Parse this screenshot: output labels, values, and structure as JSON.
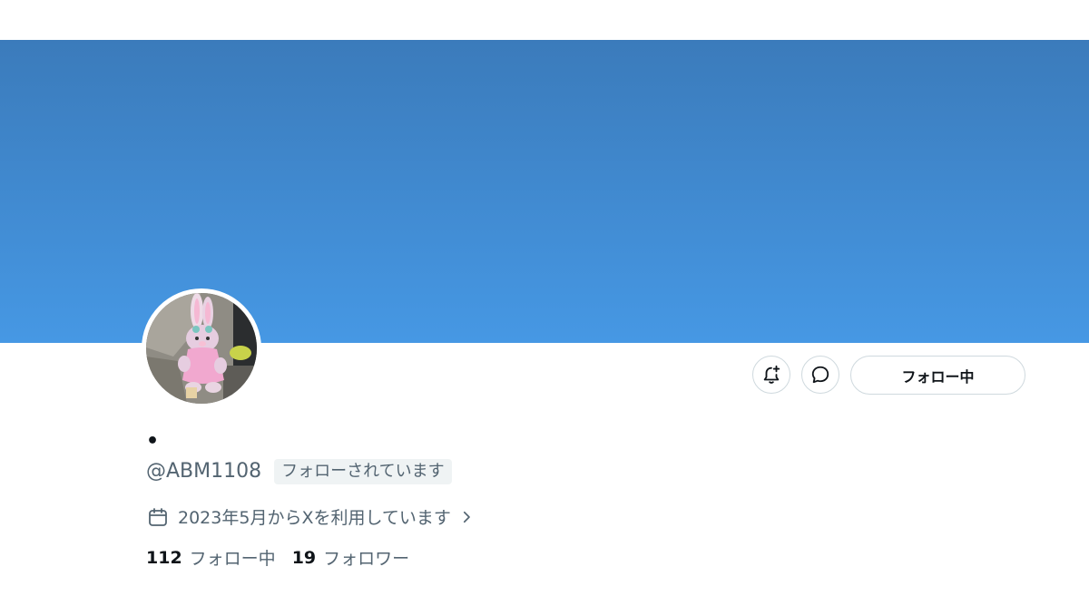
{
  "profile": {
    "display_name": "•",
    "handle": "@ABM1108",
    "follows_you_badge": "フォローされています",
    "joined_text": "2023年5月からXを利用しています",
    "following_count": "112",
    "following_label": "フォロー中",
    "followers_count": "19",
    "followers_label": "フォロワー"
  },
  "actions": {
    "follow_button_label": "フォロー中",
    "bell_icon": "bell-plus-icon",
    "message_icon": "message-icon"
  },
  "colors": {
    "banner_top": "#3b7bbb",
    "banner_bottom": "#4698e4",
    "muted_text": "#536471",
    "border": "#cfd9de"
  }
}
